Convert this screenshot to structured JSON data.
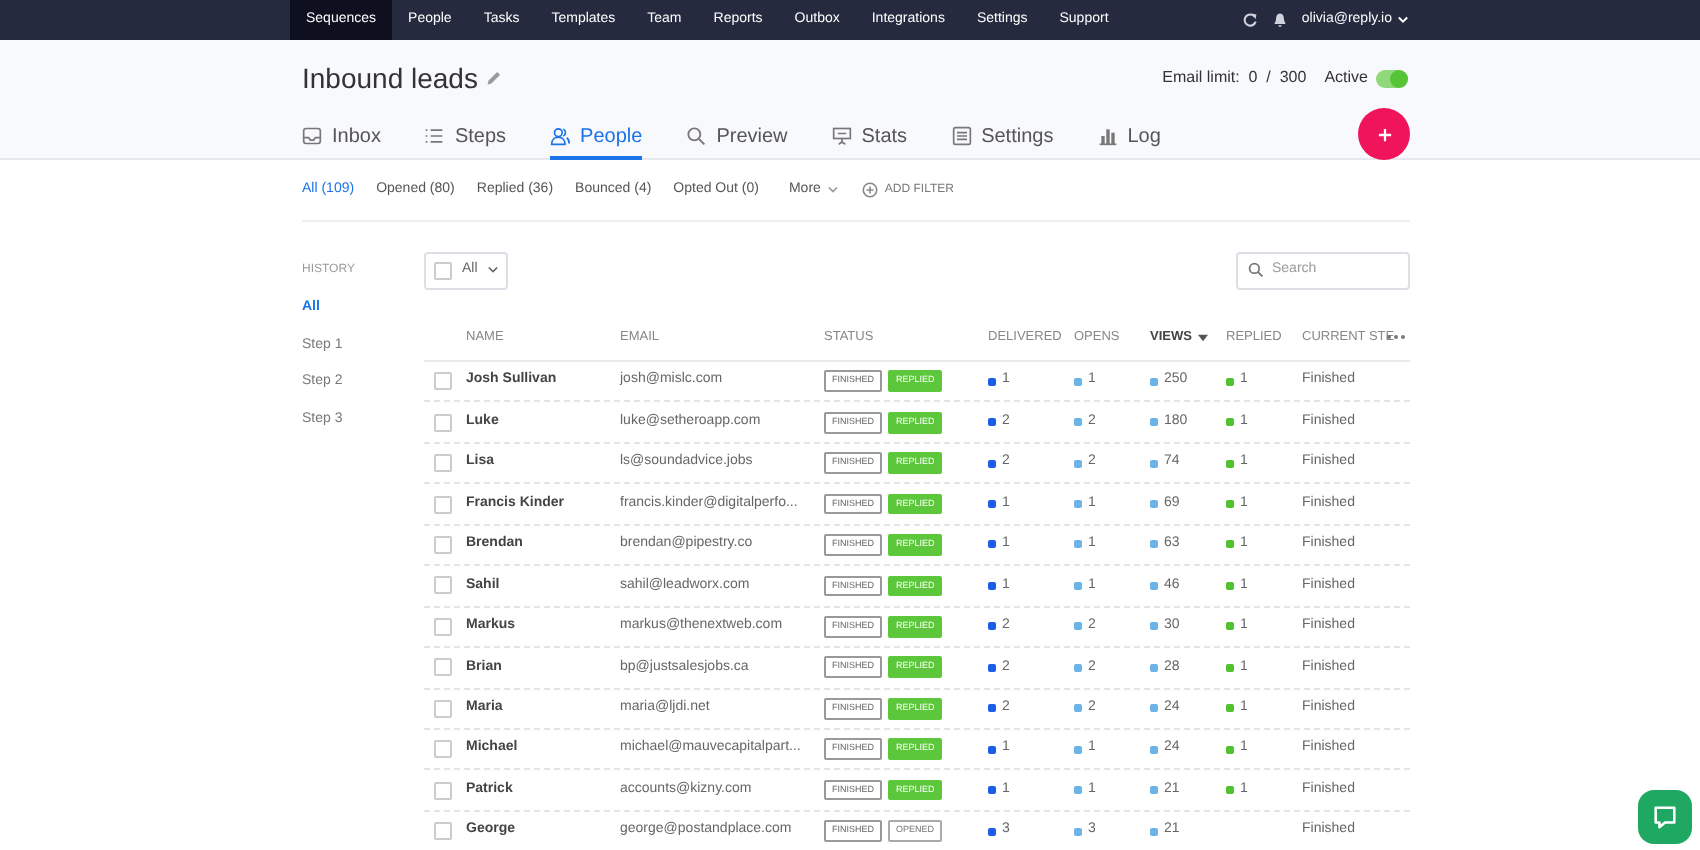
{
  "nav": {
    "items": [
      {
        "label": "Sequences",
        "selected": true
      },
      {
        "label": "People",
        "selected": false
      },
      {
        "label": "Tasks",
        "selected": false
      },
      {
        "label": "Templates",
        "selected": false
      },
      {
        "label": "Team",
        "selected": false
      },
      {
        "label": "Reports",
        "selected": false
      },
      {
        "label": "Outbox",
        "selected": false
      },
      {
        "label": "Integrations",
        "selected": false
      },
      {
        "label": "Settings",
        "selected": false
      },
      {
        "label": "Support",
        "selected": false
      }
    ],
    "user": "olivia@reply.io"
  },
  "header": {
    "title": "Inbound leads",
    "email_limit": "Email limit:  0  /  300",
    "active_label": "Active",
    "active_on": true
  },
  "tabs": [
    {
      "label": "Inbox",
      "kind": "inbox",
      "selected": false
    },
    {
      "label": "Steps",
      "kind": "steps",
      "selected": false
    },
    {
      "label": "People",
      "kind": "people",
      "selected": true
    },
    {
      "label": "Preview",
      "kind": "preview",
      "selected": false
    },
    {
      "label": "Stats",
      "kind": "stats",
      "selected": false
    },
    {
      "label": "Settings",
      "kind": "settings",
      "selected": false
    },
    {
      "label": "Log",
      "kind": "log",
      "selected": false
    }
  ],
  "filters": [
    {
      "label": "All (109)",
      "selected": true
    },
    {
      "label": "Opened (80)",
      "selected": false
    },
    {
      "label": "Replied (36)",
      "selected": false
    },
    {
      "label": "Bounced (4)",
      "selected": false
    },
    {
      "label": "Opted Out (0)",
      "selected": false
    }
  ],
  "more": "More",
  "add_filter": "ADD FILTER",
  "sidebar": {
    "heading": "HISTORY",
    "items": [
      {
        "label": "All",
        "selected": true
      },
      {
        "label": "Step 1",
        "selected": false
      },
      {
        "label": "Step 2",
        "selected": false
      },
      {
        "label": "Step 3",
        "selected": false
      }
    ]
  },
  "select_all": {
    "label": "All",
    "checked": false
  },
  "search": {
    "placeholder": "Search"
  },
  "table": {
    "columns": [
      {
        "label": "NAME",
        "sorted": false
      },
      {
        "label": "EMAIL",
        "sorted": false
      },
      {
        "label": "STATUS",
        "sorted": false
      },
      {
        "label": "DELIVERED",
        "sorted": false
      },
      {
        "label": "OPENS",
        "sorted": false
      },
      {
        "label": "VIEWS",
        "sorted": true
      },
      {
        "label": "REPLIED",
        "sorted": false
      },
      {
        "label": "CURRENT STE",
        "sorted": false
      }
    ],
    "rows": [
      {
        "checked": false,
        "name": "Josh Sullivan",
        "email": "josh@mislc.com",
        "status": "FINISHED",
        "tag": {
          "label": "REPLIED",
          "kind": "replied"
        },
        "delivered": "1",
        "opens": "1",
        "views": "250",
        "replied": "1",
        "current": "Finished"
      },
      {
        "checked": false,
        "name": "Luke",
        "email": "luke@setheroapp.com",
        "status": "FINISHED",
        "tag": {
          "label": "REPLIED",
          "kind": "replied"
        },
        "delivered": "2",
        "opens": "2",
        "views": "180",
        "replied": "1",
        "current": "Finished"
      },
      {
        "checked": false,
        "name": "Lisa",
        "email": "ls@soundadvice.jobs",
        "status": "FINISHED",
        "tag": {
          "label": "REPLIED",
          "kind": "replied"
        },
        "delivered": "2",
        "opens": "2",
        "views": "74",
        "replied": "1",
        "current": "Finished"
      },
      {
        "checked": false,
        "name": "Francis Kinder",
        "email": "francis.kinder@digitalperfo...",
        "status": "FINISHED",
        "tag": {
          "label": "REPLIED",
          "kind": "replied"
        },
        "delivered": "1",
        "opens": "1",
        "views": "69",
        "replied": "1",
        "current": "Finished"
      },
      {
        "checked": false,
        "name": "Brendan",
        "email": "brendan@pipestry.co",
        "status": "FINISHED",
        "tag": {
          "label": "REPLIED",
          "kind": "replied"
        },
        "delivered": "1",
        "opens": "1",
        "views": "63",
        "replied": "1",
        "current": "Finished"
      },
      {
        "checked": false,
        "name": "Sahil",
        "email": "sahil@leadworx.com",
        "status": "FINISHED",
        "tag": {
          "label": "REPLIED",
          "kind": "replied"
        },
        "delivered": "1",
        "opens": "1",
        "views": "46",
        "replied": "1",
        "current": "Finished"
      },
      {
        "checked": false,
        "name": "Markus",
        "email": "markus@thenextweb.com",
        "status": "FINISHED",
        "tag": {
          "label": "REPLIED",
          "kind": "replied"
        },
        "delivered": "2",
        "opens": "2",
        "views": "30",
        "replied": "1",
        "current": "Finished"
      },
      {
        "checked": false,
        "name": "Brian",
        "email": "bp@justsalesjobs.ca",
        "status": "FINISHED",
        "tag": {
          "label": "REPLIED",
          "kind": "replied"
        },
        "delivered": "2",
        "opens": "2",
        "views": "28",
        "replied": "1",
        "current": "Finished"
      },
      {
        "checked": false,
        "name": "Maria",
        "email": "maria@ljdi.net",
        "status": "FINISHED",
        "tag": {
          "label": "REPLIED",
          "kind": "replied"
        },
        "delivered": "2",
        "opens": "2",
        "views": "24",
        "replied": "1",
        "current": "Finished"
      },
      {
        "checked": false,
        "name": "Michael",
        "email": "michael@mauvecapitalpart...",
        "status": "FINISHED",
        "tag": {
          "label": "REPLIED",
          "kind": "replied"
        },
        "delivered": "1",
        "opens": "1",
        "views": "24",
        "replied": "1",
        "current": "Finished"
      },
      {
        "checked": false,
        "name": "Patrick",
        "email": "accounts@kizny.com",
        "status": "FINISHED",
        "tag": {
          "label": "REPLIED",
          "kind": "replied"
        },
        "delivered": "1",
        "opens": "1",
        "views": "21",
        "replied": "1",
        "current": "Finished"
      },
      {
        "checked": false,
        "name": "George",
        "email": "george@postandplace.com",
        "status": "FINISHED",
        "tag": {
          "label": "OPENED",
          "kind": "opened"
        },
        "delivered": "3",
        "opens": "3",
        "views": "21",
        "current": "Finished"
      }
    ]
  }
}
